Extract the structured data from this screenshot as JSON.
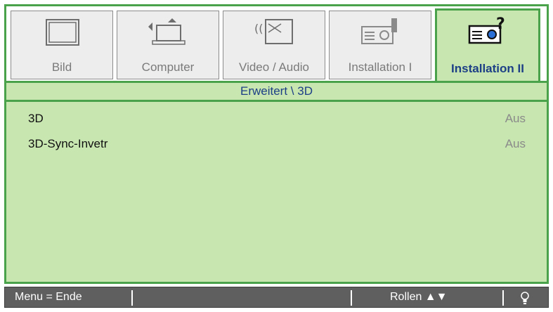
{
  "tabs": [
    {
      "label": "Bild",
      "icon": "monitor-icon",
      "active": false
    },
    {
      "label": "Computer",
      "icon": "laptop-icon",
      "active": false
    },
    {
      "label": "Video / Audio",
      "icon": "video-audio-icon",
      "active": false
    },
    {
      "label": "Installation I",
      "icon": "projector-icon",
      "active": false
    },
    {
      "label": "Installation II",
      "icon": "projector-help-icon",
      "active": true
    }
  ],
  "breadcrumb": "Erweitert \\ 3D",
  "settings": [
    {
      "name": "3D",
      "value": "Aus"
    },
    {
      "name": "3D-Sync-Invetr",
      "value": "Aus"
    }
  ],
  "footer": {
    "menu_hint": "Menu = Ende",
    "scroll_hint": "Rollen ▲▼",
    "bulb_icon": "lightbulb-icon"
  },
  "colors": {
    "accent_green": "#4aa24a",
    "panel_bg": "#c8e6b0",
    "active_text": "#1d3f86",
    "footer_bg": "#5f5f5f"
  }
}
